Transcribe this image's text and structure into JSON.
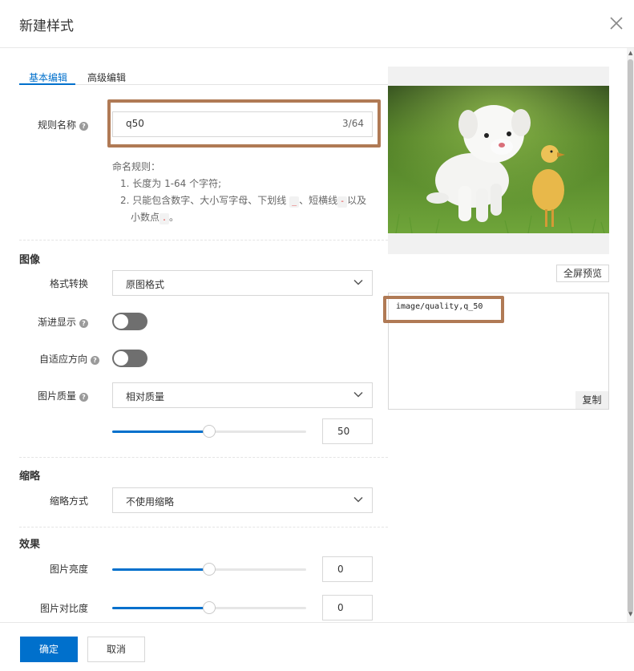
{
  "dialog": {
    "title": "新建样式"
  },
  "tabs": [
    {
      "label": "基本编辑",
      "active": true
    },
    {
      "label": "高级编辑",
      "active": false
    }
  ],
  "rule_name": {
    "label": "规则名称",
    "value": "q50",
    "count": "3/64",
    "naming_title": "命名规则：",
    "naming_rule_1": "1. 长度为 1-64 个字符;",
    "naming_rule_2_a": "2. 只能包含数字、大小写字母、下划线",
    "code_underscore": "_",
    "naming_rule_2_b": "、短横线",
    "code_dash": "-",
    "naming_rule_2_c": "以及",
    "naming_rule_2_d": "小数点",
    "code_dot": ".",
    "naming_rule_2_e": "。"
  },
  "image_section": {
    "title": "图像",
    "format": {
      "label": "格式转换",
      "value": "原图格式"
    },
    "progressive": {
      "label": "渐进显示",
      "on": false
    },
    "auto_orient": {
      "label": "自适应方向",
      "on": false
    },
    "quality": {
      "label": "图片质量",
      "mode": "相对质量",
      "value": "50",
      "fraction": 0.5
    }
  },
  "thumbnail_section": {
    "title": "缩略",
    "method": {
      "label": "缩略方式",
      "value": "不使用缩略"
    }
  },
  "effect_section": {
    "title": "效果",
    "brightness": {
      "label": "图片亮度",
      "value": "0",
      "fraction": 0.5
    },
    "contrast": {
      "label": "图片对比度",
      "value": "0",
      "fraction": 0.5
    }
  },
  "preview": {
    "fullscreen_label": "全屏预览",
    "code": "image/quality,q_50",
    "copy_label": "复制"
  },
  "footer": {
    "ok_label": "确定",
    "cancel_label": "取消"
  },
  "colors": {
    "primary": "#0070cc",
    "highlight_border": "#b07a55",
    "toggle_off": "#6f6f6f"
  }
}
